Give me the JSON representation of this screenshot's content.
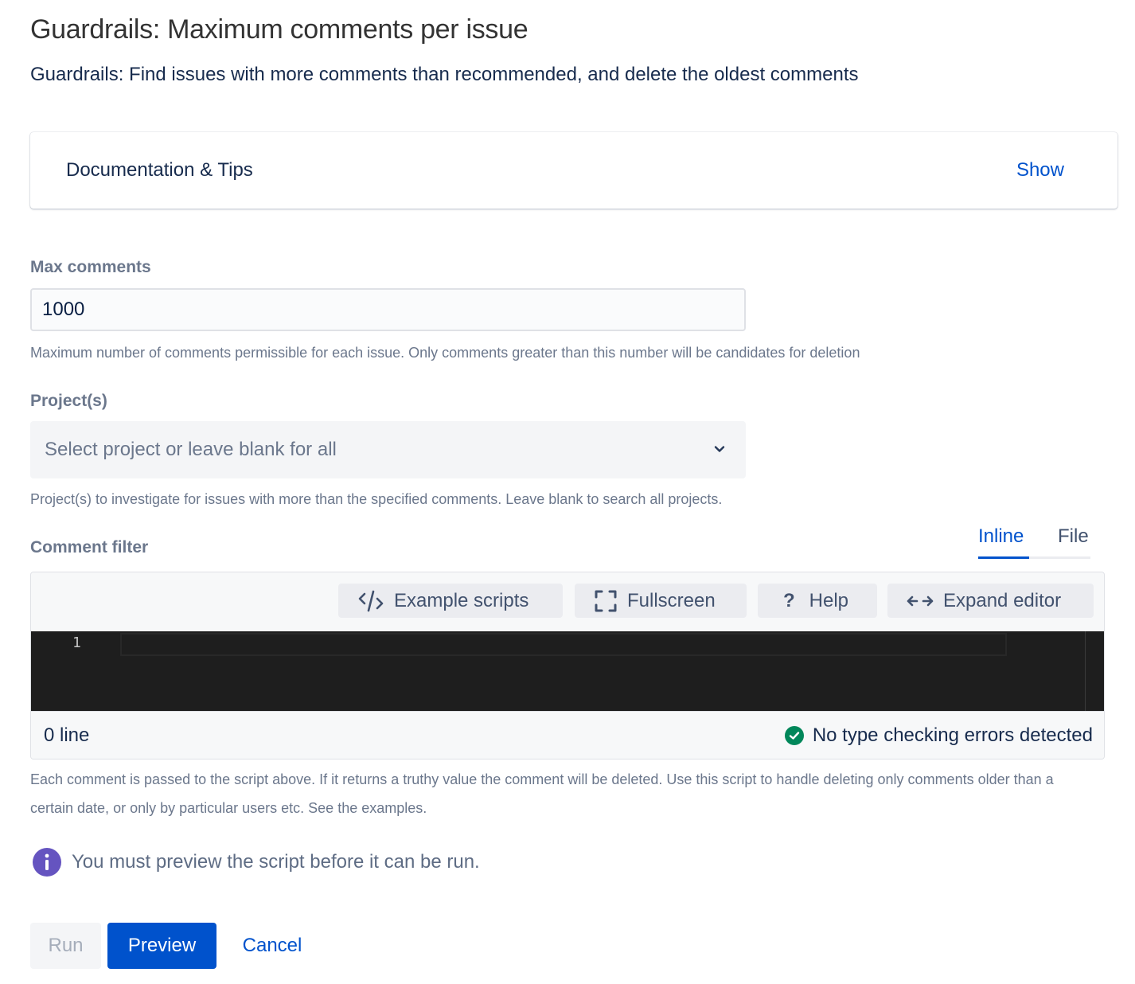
{
  "header": {
    "title": "Guardrails: Maximum comments per issue",
    "subtitle": "Guardrails: Find issues with more comments than recommended, and delete the oldest comments"
  },
  "documentation": {
    "title": "Documentation & Tips",
    "toggle_label": "Show"
  },
  "max_comments": {
    "label": "Max comments",
    "value": "1000",
    "helper": "Maximum number of comments permissible for each issue. Only comments greater than this number will be candidates for deletion"
  },
  "projects": {
    "label": "Project(s)",
    "placeholder": "Select project or leave blank for all",
    "helper": "Project(s) to investigate for issues with more than the specified comments. Leave blank to search all projects."
  },
  "comment_filter": {
    "label": "Comment filter",
    "tabs": [
      {
        "label": "Inline",
        "active": true
      },
      {
        "label": "File",
        "active": false
      }
    ],
    "toolbar": [
      {
        "label": "Example scripts",
        "icon": "code-icon"
      },
      {
        "label": "Fullscreen",
        "icon": "fullscreen-icon"
      },
      {
        "label": "Help",
        "icon": "question-icon"
      },
      {
        "label": "Expand editor",
        "icon": "expand-arrows-icon"
      }
    ],
    "editor": {
      "line_numbers": [
        "1"
      ],
      "content": ""
    },
    "status": {
      "line_count": "0 line",
      "type_check": "No type checking errors detected"
    },
    "helper": "Each comment is passed to the script above. If it returns a truthy value the comment will be deleted. Use this script to handle deleting only comments older than a certain date, or only by particular users etc. See the examples."
  },
  "info": {
    "message": "You must preview the script before it can be run."
  },
  "actions": {
    "run": "Run",
    "preview": "Preview",
    "cancel": "Cancel"
  },
  "colors": {
    "primary": "#0052cc",
    "success": "#00875a",
    "info": "#6554c0",
    "editor_bg": "#1e1e1e"
  }
}
